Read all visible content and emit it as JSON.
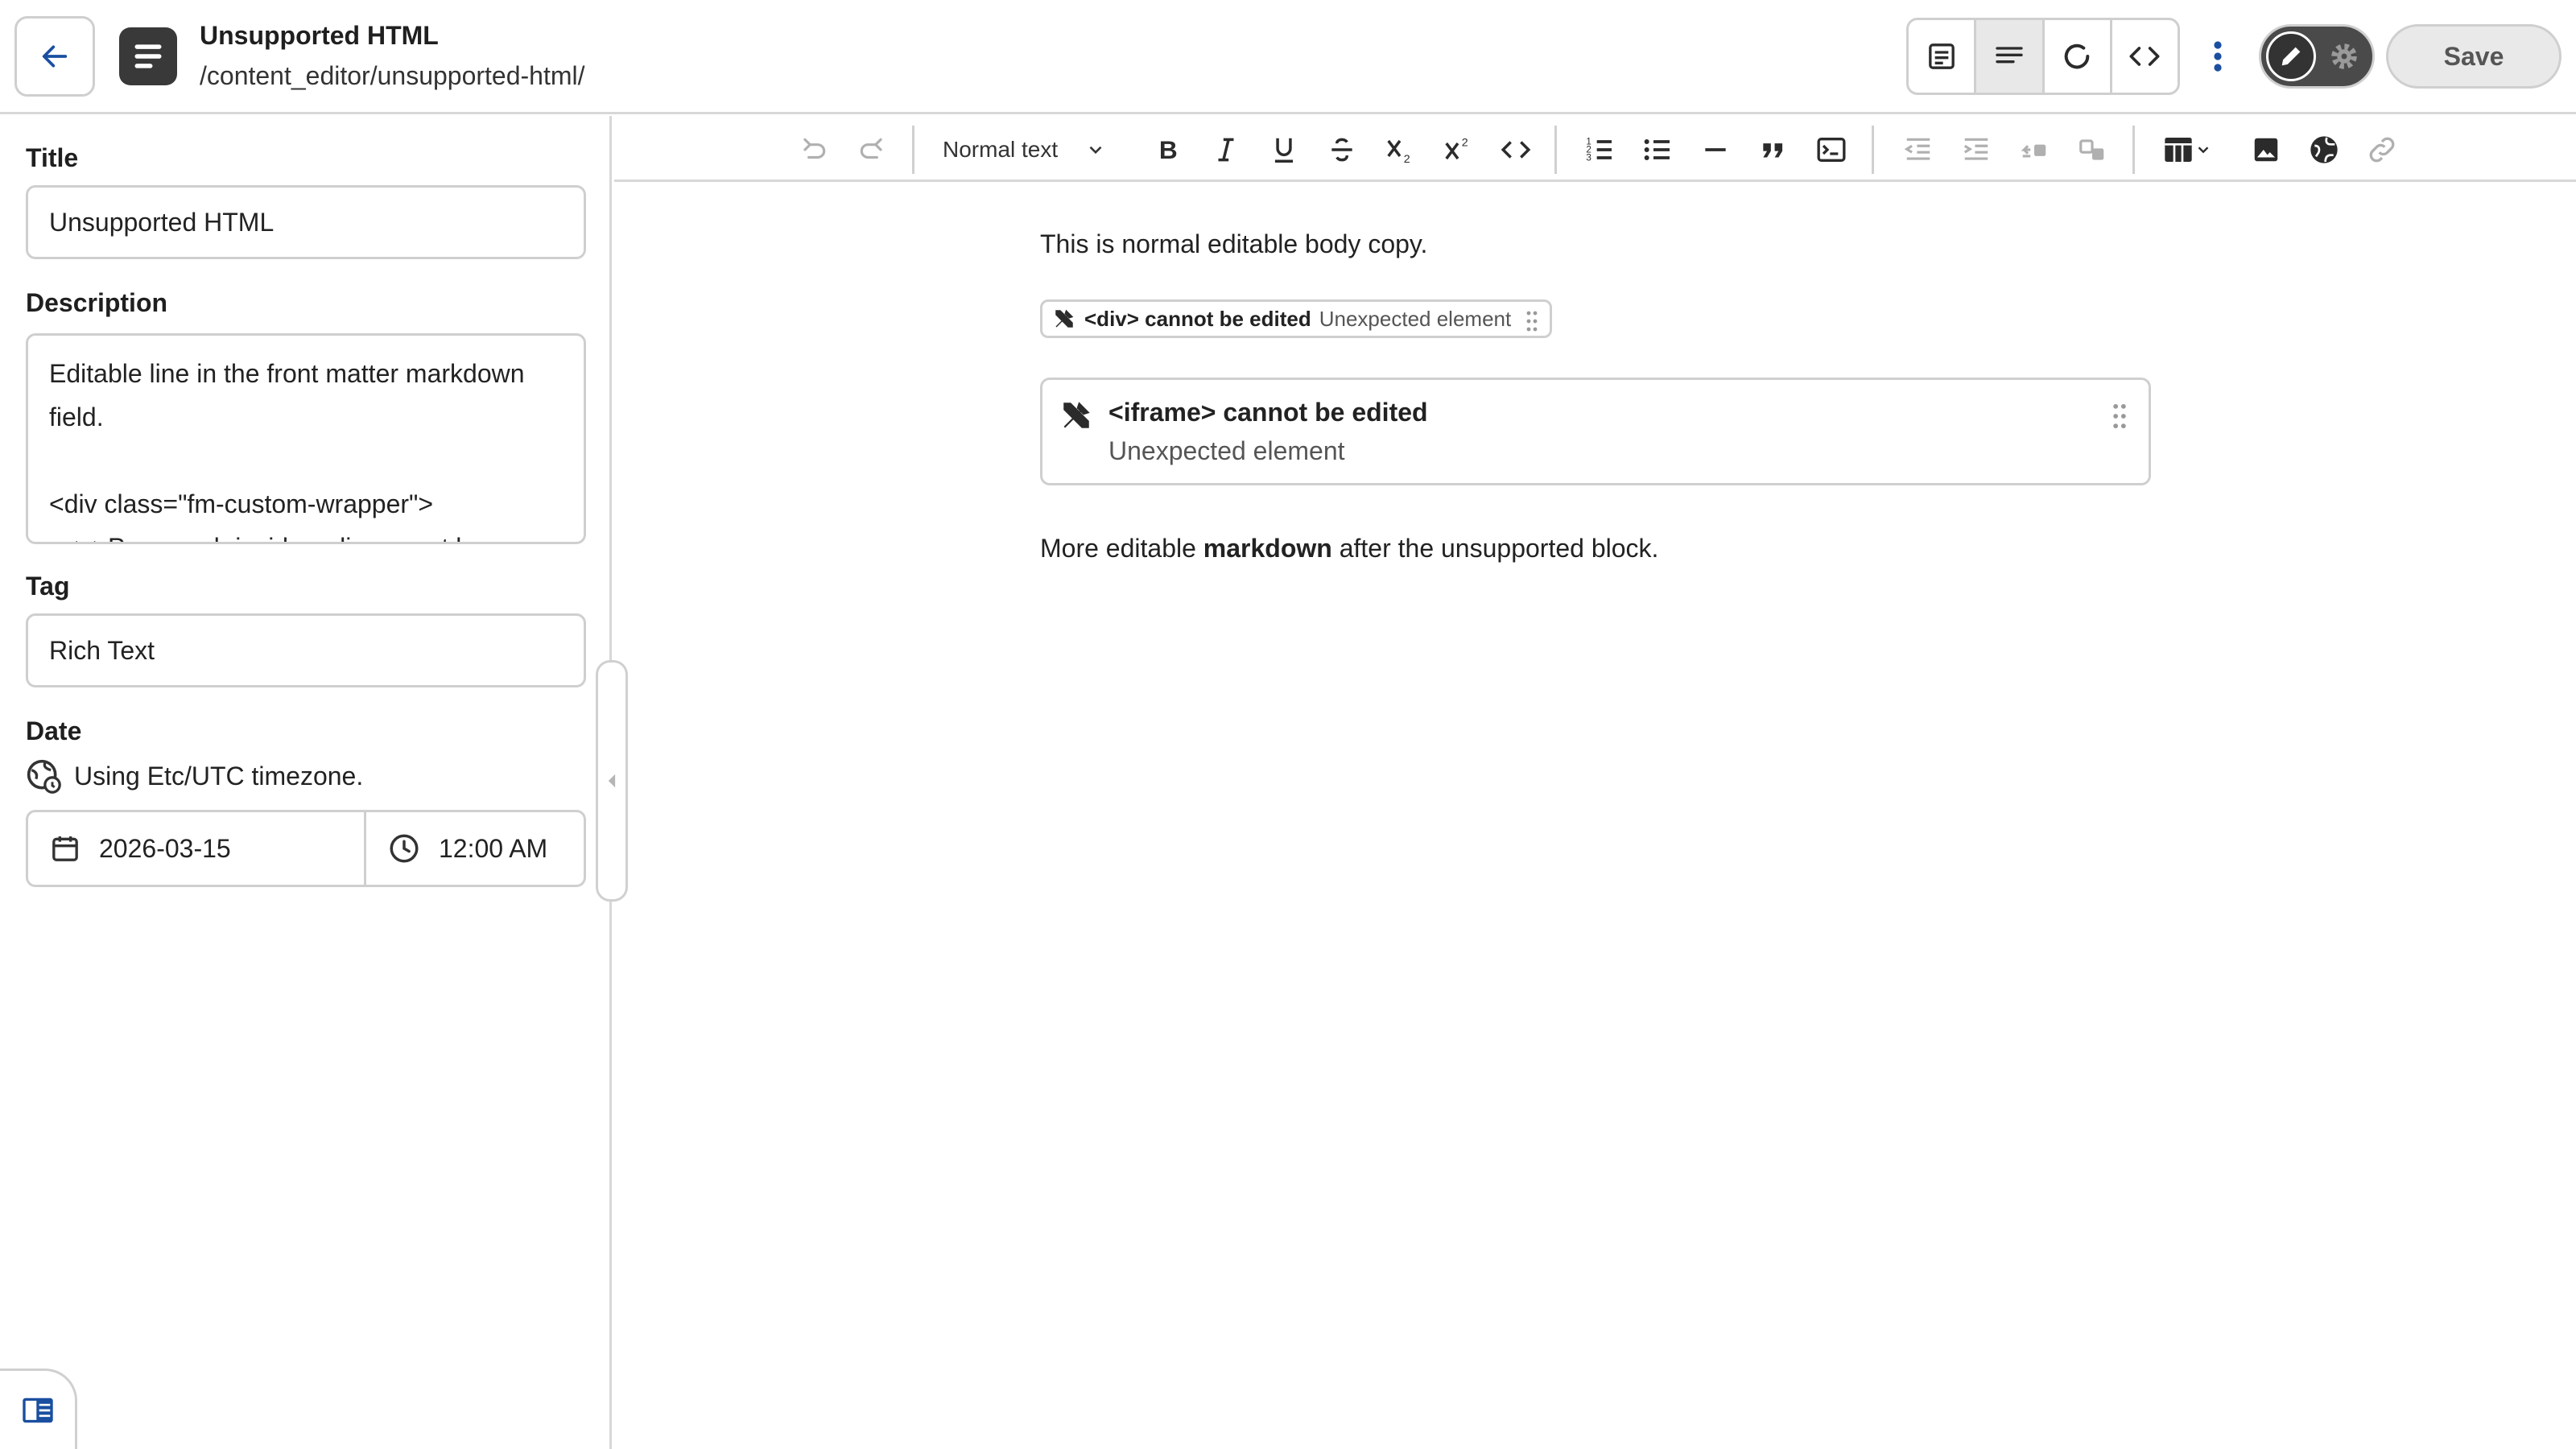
{
  "header": {
    "title": "Unsupported HTML",
    "path": "/content_editor/unsupported-html/",
    "save_label": "Save"
  },
  "sidebar": {
    "title_label": "Title",
    "title_value": "Unsupported HTML",
    "description_label": "Description",
    "description_value": "Editable line in the front matter markdown field.\n\n<div class=\"fm-custom-wrapper\">\n  <p>Paragraph inside a div cannot be",
    "tag_label": "Tag",
    "tag_value": "Rich Text",
    "date_label": "Date",
    "timezone_text": "Using Etc/UTC timezone.",
    "date_value": "2026-03-15",
    "time_value": "12:00 AM"
  },
  "toolbar": {
    "text_style": "Normal text"
  },
  "editor": {
    "para1": "This is normal editable body copy.",
    "chip_title": "<div> cannot be edited",
    "chip_sub": "Unexpected element",
    "block_title": "<iframe> cannot be edited",
    "block_sub": "Unexpected element",
    "para2_before": "More editable ",
    "para2_bold": "markdown",
    "para2_after": " after the unsupported block."
  },
  "colors": {
    "accent": "#1a4fa0",
    "border": "#cfcfcf",
    "toggle_bg": "#4a4a4a"
  }
}
